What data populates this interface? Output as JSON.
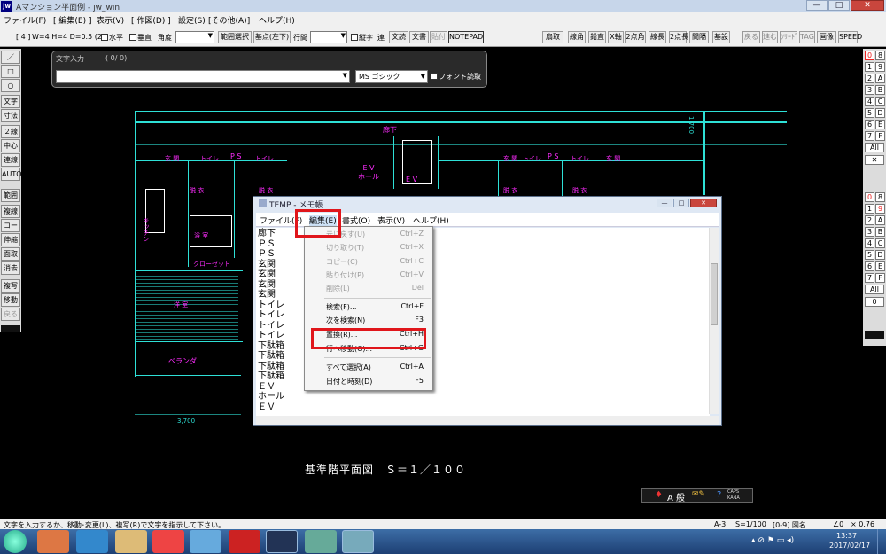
{
  "window": {
    "title": "Aマンション平面例 - jw_win",
    "icon": "jw",
    "min": "—",
    "max": "□",
    "close": "✕"
  },
  "menu": [
    "ファイル(F)",
    "[ 編集(E) ]",
    "表示(V)",
    "[ 作図(D) ]",
    "設定(S)",
    "[その他(A)]",
    "ヘルプ(H)"
  ],
  "toolbar": {
    "mode": "[ 4 ]",
    "size": "W=4 H=4 D=0.5 (2)",
    "horizontal": "水平",
    "vertical": "垂直",
    "angle": "角度",
    "range_select": "範囲選択",
    "base_point": "基点(左下)",
    "line_spacing": "行間",
    "vertical_text": "縦字",
    "ren": "連",
    "text_read": "文読",
    "text_write": "文書",
    "notepad_dim": "貼付",
    "notepad": "NOTEPAD"
  },
  "toolbar_right": [
    "扇取",
    "線角",
    "鉛直",
    "X軸",
    "2点角",
    "線長",
    "2点長",
    "間隔",
    "基設",
    "戻る",
    "進む",
    "ﾂﾘｰﾄﾞ",
    "TAG",
    "画像",
    "SPEED"
  ],
  "left_tools": [
    "／",
    "□",
    "○",
    "文字",
    "寸法",
    "２線",
    "中心線",
    "連線",
    "AUTO",
    "範囲",
    "複線",
    "コーナー",
    "伸縮",
    "面取",
    "消去",
    "複写",
    "移動",
    "戻る"
  ],
  "right_tools_top": [
    "0",
    "8",
    "1",
    "9",
    "2",
    "A",
    "3",
    "B",
    "4",
    "C",
    "5",
    "D",
    "6",
    "E",
    "7",
    "F",
    "All",
    "✕"
  ],
  "right_tools_mid": [
    "0",
    "8",
    "1",
    "9",
    "2",
    "A",
    "3",
    "B",
    "4",
    "C",
    "5",
    "D",
    "6",
    "E",
    "7",
    "F",
    "All",
    "0"
  ],
  "text_input": {
    "title": "文字入力",
    "count": "( 0/ 0)",
    "font": "MS ゴシック",
    "font_read": "フォント読取"
  },
  "plan": {
    "corridor": "廊下",
    "ev_hall": "E V\nホール",
    "ev": "E V",
    "entrance": "玄 関",
    "toilet": "トイレ",
    "ps": "P S",
    "kitchen": "キッチン",
    "dressing": "脱 衣",
    "bath": "浴 室",
    "closet": "クローゼット",
    "room": "洋 室",
    "balcony": "ベランダ",
    "dim_right": "1,700",
    "dim_bottom": "3,700",
    "caption": "基準階平面図　Ｓ＝１／１００"
  },
  "notepad": {
    "title": "TEMP - メモ帳",
    "menu": [
      "ファイル(F)",
      "編集(E)",
      "書式(O)",
      "表示(V)",
      "ヘルプ(H)"
    ],
    "lines": [
      "廊下",
      "ＰＳ",
      "ＰＳ",
      "玄関",
      "玄関",
      "玄関",
      "玄関",
      "トイレ",
      "トイレ",
      "トイレ",
      "トイレ",
      "下駄箱",
      "下駄箱",
      "下駄箱",
      "下駄箱",
      "ＥＶ",
      "ホール",
      "ＥＶ"
    ]
  },
  "edit_menu": [
    {
      "label": "元に戻す(U)",
      "key": "Ctrl+Z",
      "disabled": true
    },
    {
      "label": "切り取り(T)",
      "key": "Ctrl+X",
      "disabled": true
    },
    {
      "label": "コピー(C)",
      "key": "Ctrl+C",
      "disabled": true
    },
    {
      "label": "貼り付け(P)",
      "key": "Ctrl+V",
      "disabled": true
    },
    {
      "label": "削除(L)",
      "key": "Del",
      "disabled": true
    },
    {
      "label": "検索(F)...",
      "key": "Ctrl+F",
      "disabled": false
    },
    {
      "label": "次を検索(N)",
      "key": "F3",
      "disabled": false
    },
    {
      "label": "置換(R)...",
      "key": "Ctrl+H",
      "disabled": false
    },
    {
      "label": "行へ移動(G)...",
      "key": "Ctrl+G",
      "disabled": false
    },
    {
      "label": "すべて選択(A)",
      "key": "Ctrl+A",
      "disabled": false
    },
    {
      "label": "日付と時刻(D)",
      "key": "F5",
      "disabled": false
    }
  ],
  "status": {
    "message": "文字を入力するか、移動･変更(L)、複写(R)で文字を指示して下さい。",
    "sheet": "A-3",
    "scale": "S=1/100",
    "layer": "[0-9] 図名",
    "angle": "∠0",
    "zoom": "× 0.76"
  },
  "ime": {
    "mode": "A 般",
    "caps": "CAPS",
    "kana": "KANA"
  },
  "taskbar": {
    "time": "13:37",
    "date": "2017/02/17"
  },
  "colors": {
    "highlight": "#e0161b",
    "plan_lines": "#2ee0d6",
    "plan_labels": "#ff2cff",
    "titlebar": "#c7d6ea"
  }
}
